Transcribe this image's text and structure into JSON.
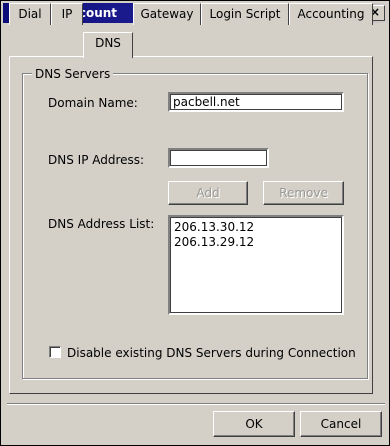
{
  "window": {
    "title": "New Account",
    "close_glyph": "×"
  },
  "tabs": [
    {
      "label": "Dial",
      "active": false
    },
    {
      "label": "IP",
      "active": false
    },
    {
      "label": "DNS",
      "active": true
    },
    {
      "label": "Gateway",
      "active": false
    },
    {
      "label": "Login Script",
      "active": false
    },
    {
      "label": "Accounting",
      "active": false
    }
  ],
  "dns_group": {
    "title": "DNS Servers",
    "domain_name_label": "Domain Name:",
    "domain_name_value": "pacbell.net",
    "dns_ip_label": "DNS IP Address:",
    "dns_ip_value": "",
    "add_label": "Add",
    "remove_label": "Remove",
    "address_list_label": "DNS Address List:",
    "address_list": [
      "206.13.30.12",
      "206.13.29.12"
    ],
    "disable_checkbox_label": "Disable existing DNS Servers during Connection",
    "disable_checked": false
  },
  "footer": {
    "ok_label": "OK",
    "cancel_label": "Cancel"
  },
  "colors": {
    "titlebar_start": "#0c0c7a",
    "face": "#d4d0c8"
  },
  "icons": {
    "app": "kppp-icon",
    "close": "close-icon"
  }
}
